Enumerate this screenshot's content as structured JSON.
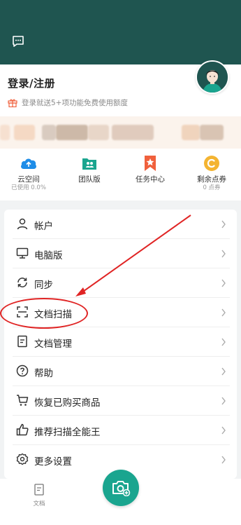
{
  "profile": {
    "login_title": "登录/注册",
    "promo_text": "登录就送5+项功能免费使用额度"
  },
  "quick_items": [
    {
      "label": "云空间",
      "sub": "已使用 0.0%",
      "icon": "cloud-upload-icon",
      "color": "#1e8de8"
    },
    {
      "label": "团队版",
      "sub": "",
      "icon": "team-folder-icon",
      "color": "#1aa58f"
    },
    {
      "label": "任务中心",
      "sub": "",
      "icon": "bookmark-star-icon",
      "color": "#f0603c"
    },
    {
      "label": "剩余点券",
      "sub": "0 点券",
      "icon": "coupon-icon",
      "color": "#f4b431"
    }
  ],
  "menu": [
    {
      "label": "帐户",
      "icon": "person-icon"
    },
    {
      "label": "电脑版",
      "icon": "monitor-icon"
    },
    {
      "label": "同步",
      "icon": "sync-icon"
    },
    {
      "label": "文档扫描",
      "icon": "scan-icon"
    },
    {
      "label": "文档管理",
      "icon": "document-icon"
    },
    {
      "label": "帮助",
      "icon": "help-icon"
    },
    {
      "label": "恢复已购买商品",
      "icon": "cart-icon"
    },
    {
      "label": "推荐扫描全能王",
      "icon": "thumbs-up-icon"
    },
    {
      "label": "更多设置",
      "icon": "gear-icon"
    }
  ],
  "bottom_nav": {
    "docs_label": "文档"
  },
  "colors": {
    "header_bg": "#1f5550",
    "accent": "#1aa58f",
    "annotation": "#e02424"
  }
}
